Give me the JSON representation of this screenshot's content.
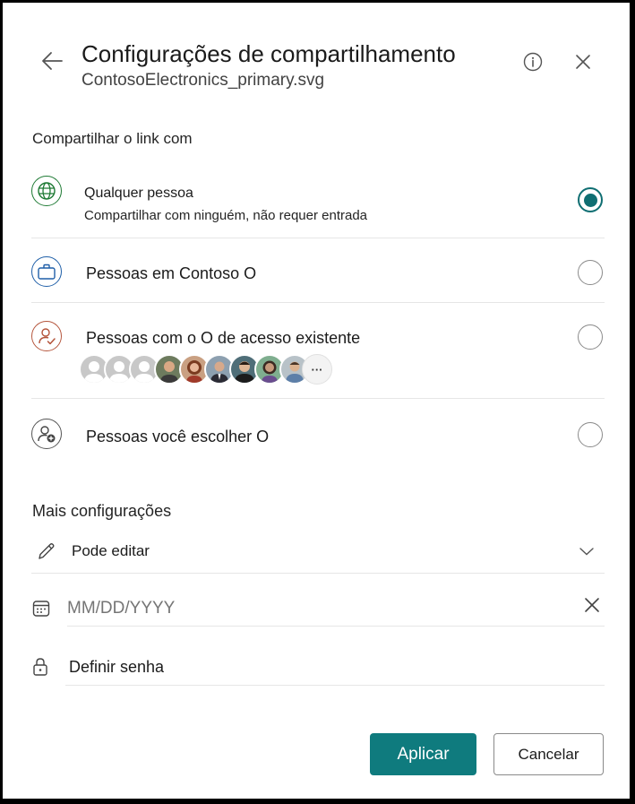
{
  "header": {
    "title": "Configurações de compartilhamento",
    "filename": "ContosoElectronics_primary.svg",
    "back_icon": "arrow-left-icon",
    "info_icon": "info-icon",
    "close_icon": "close-icon"
  },
  "share_section": {
    "heading": "Compartilhar o link com",
    "options": [
      {
        "title": "Qualquer pessoa",
        "description": "Compartilhar com ninguém, não requer entrada",
        "icon": "globe-icon",
        "selected": true
      },
      {
        "title": "Pessoas em Contoso O",
        "icon": "briefcase-icon",
        "selected": false
      },
      {
        "title": "Pessoas com o O de acesso existente",
        "icon": "person-check-icon",
        "selected": false
      },
      {
        "title": "Pessoas você escolher O",
        "icon": "person-add-icon",
        "selected": false
      }
    ],
    "more_avatars_label": "···"
  },
  "more_settings": {
    "heading": "Mais configurações",
    "permission": {
      "value": "Pode editar",
      "icon": "pencil-icon"
    },
    "date": {
      "placeholder": "MM/DD/YYYY",
      "icon": "calendar-icon"
    },
    "password": {
      "label": "Definir senha",
      "icon": "lock-icon"
    }
  },
  "footer": {
    "apply_label": "Aplicar",
    "cancel_label": "Cancelar"
  },
  "colors": {
    "accent": "#0f7b7e",
    "globe": "#1e7a34",
    "briefcase": "#1f5fa8",
    "person": "#b4533a"
  }
}
